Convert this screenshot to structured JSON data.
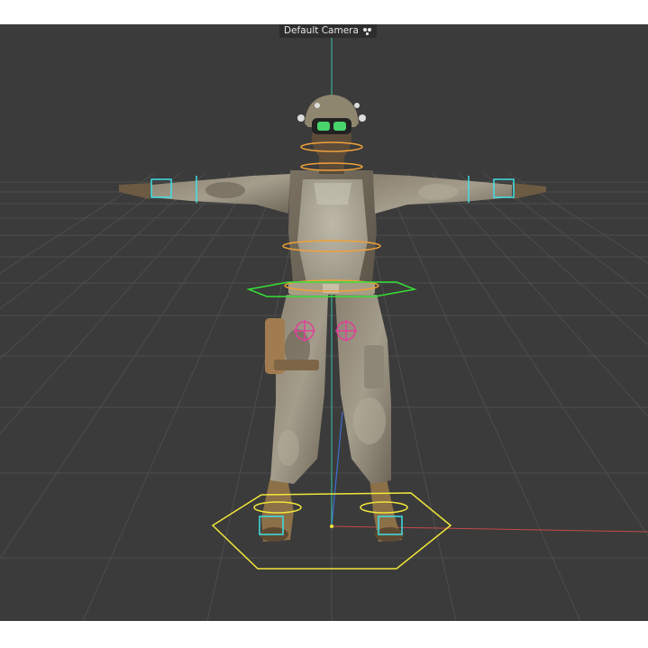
{
  "viewport": {
    "camera_label": "Default Camera",
    "camera_icon": "camera-options-icon",
    "colors": {
      "background": "#3b3b3b",
      "grid": "#4d4d4d",
      "grid_major": "#575757",
      "axis_x": "#c44a4a",
      "axis_y": "#34c7a3",
      "axis_z": "#3d6fd4",
      "joint_orange": "#f0a13a",
      "root_controller": "#35e035",
      "floor_controller": "#f0e63a",
      "limb_controller": "#3fe0e8",
      "hip_target": "#e0409a"
    }
  }
}
